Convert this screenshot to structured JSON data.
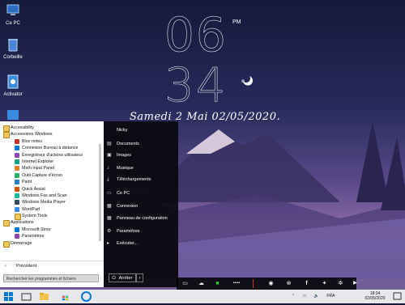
{
  "desktop_icons": [
    {
      "label": "Ce PC",
      "icon": "computer-icon"
    },
    {
      "label": "Corbeille",
      "icon": "recycle-bin-icon"
    },
    {
      "label": "Activator",
      "icon": "activator-icon"
    }
  ],
  "clock": {
    "hours": "06",
    "minutes": "34",
    "ampm": "PM"
  },
  "date_text": "Samedi 2 Mai 02/05/2020.",
  "start_menu": {
    "programs": [
      {
        "label": "Accessibility",
        "type": "folder",
        "indent": 0
      },
      {
        "label": "Accessoires Windows",
        "type": "folder",
        "indent": 0
      },
      {
        "label": "Bloc-notes",
        "type": "app",
        "indent": 1
      },
      {
        "label": "Connexion Bureau à distance",
        "type": "app",
        "indent": 1
      },
      {
        "label": "Enregistreur d'actions utilisateur",
        "type": "app",
        "indent": 1
      },
      {
        "label": "Internet Explorer",
        "type": "app",
        "indent": 1
      },
      {
        "label": "Math Input Panel",
        "type": "app",
        "indent": 1
      },
      {
        "label": "Outil Capture d'écran",
        "type": "app",
        "indent": 1
      },
      {
        "label": "Paint",
        "type": "app",
        "indent": 1
      },
      {
        "label": "Quick Assist",
        "type": "app",
        "indent": 1
      },
      {
        "label": "Windows Fax and Scan",
        "type": "app",
        "indent": 1
      },
      {
        "label": "Windows Media Player",
        "type": "app",
        "indent": 1
      },
      {
        "label": "WordPad",
        "type": "app",
        "indent": 1
      },
      {
        "label": "System Tools",
        "type": "folder",
        "indent": 1
      },
      {
        "label": "Applications",
        "type": "folder",
        "indent": 0
      },
      {
        "label": "Microsoft Store",
        "type": "app",
        "indent": 1
      },
      {
        "label": "Paramètres",
        "type": "app",
        "indent": 1
      },
      {
        "label": "Démarrage",
        "type": "folder",
        "indent": 0
      }
    ],
    "back_label": "Précédent",
    "search_placeholder": "Rechercher les programmes et fichiers",
    "right_items": [
      "Nicky",
      "Documents",
      "Images",
      "Musique",
      "Téléchargements",
      "Ce PC",
      "Connexion",
      "Panneau de configuration",
      "Paramètres",
      "Exécuter..."
    ],
    "shutdown_label": "Arrêter"
  },
  "dock": {
    "items": [
      "monitor-icon",
      "cloud-download-icon",
      "trash-icon",
      "dots-icon",
      "obs-icon",
      "steam-icon",
      "facebook-icon",
      "twitter-icon",
      "settings-icon",
      "youtube-icon"
    ],
    "dots_text": "•••••"
  },
  "taskbar": {
    "language": "FRA",
    "time": "18:34",
    "date": "02/05/2020",
    "accent": "#0078d7"
  }
}
